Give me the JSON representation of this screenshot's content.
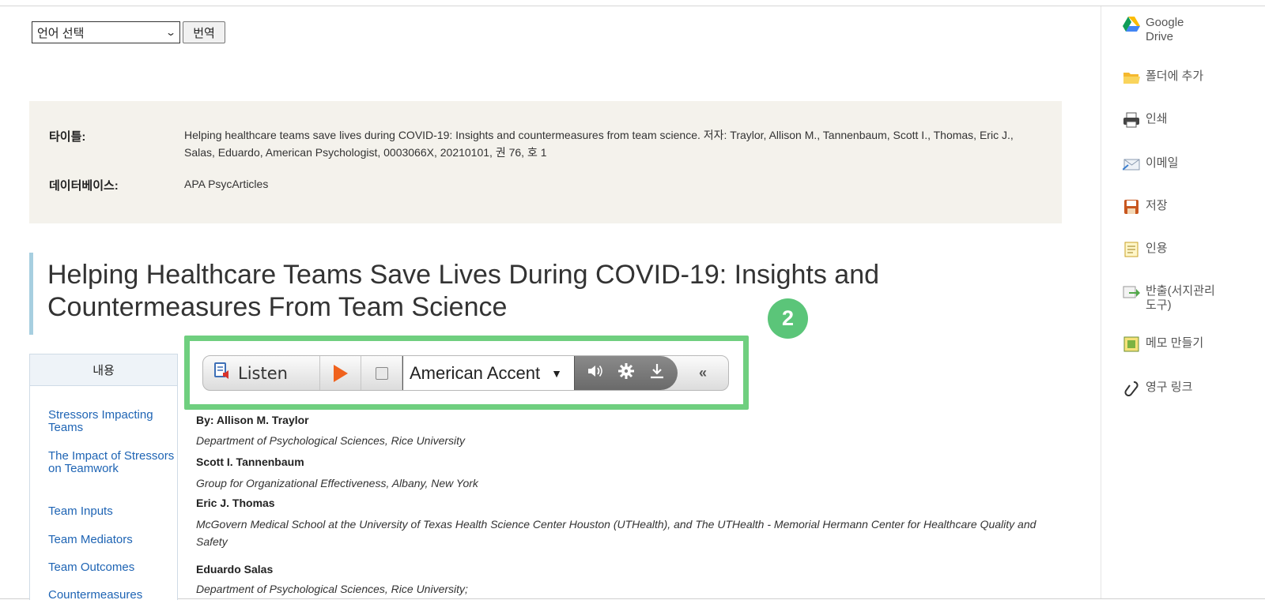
{
  "translate": {
    "select_value": "언어 선택",
    "button": "번역"
  },
  "citation": {
    "title_label": "타이틀:",
    "title_value": "Helping healthcare teams save lives during COVID-19: Insights and countermeasures from team science. 저자: Traylor, Allison M., Tannenbaum, Scott I., Thomas, Eric J., Salas, Eduardo, American Psychologist, 0003066X, 20210101, 권 76, 호 1",
    "db_label": "데이터베이스:",
    "db_value": "APA PsycArticles"
  },
  "article": {
    "title": "Helping Healthcare Teams Save Lives During COVID-19: Insights and Countermeasures From Team Science",
    "step_badge": "2"
  },
  "toc": {
    "heading": "내용",
    "items": [
      "Stressors Impacting Teams",
      "The Impact of Stressors on Teamwork",
      "Team Inputs",
      "Team Mediators",
      "Team Outcomes",
      "Countermeasures"
    ]
  },
  "readspeaker": {
    "listen": "Listen",
    "voice": "American Accent",
    "collapse": "«"
  },
  "authors": [
    {
      "name": "By: Allison M. Traylor",
      "affiliation": "Department of Psychological Sciences, Rice University"
    },
    {
      "name": "Scott I. Tannenbaum",
      "affiliation": "Group for Organizational Effectiveness, Albany, New York"
    },
    {
      "name": "Eric J. Thomas",
      "affiliation": "McGovern Medical School at the University of Texas Health Science Center Houston (UTHealth), and The UTHealth - Memorial Hermann Center for Healthcare Quality and Safety"
    },
    {
      "name": "Eduardo Salas",
      "affiliation": "Department of Psychological Sciences, Rice University;"
    }
  ],
  "tools": [
    {
      "icon": "google-drive-icon",
      "label": "Google Drive"
    },
    {
      "icon": "folder-icon",
      "label": "폴더에 추가"
    },
    {
      "icon": "print-icon",
      "label": "인쇄"
    },
    {
      "icon": "email-icon",
      "label": "이메일"
    },
    {
      "icon": "save-icon",
      "label": "저장"
    },
    {
      "icon": "cite-icon",
      "label": "인용"
    },
    {
      "icon": "export-icon",
      "label": "반출(서지관리도구)"
    },
    {
      "icon": "note-icon",
      "label": "메모 만들기"
    },
    {
      "icon": "permalink-icon",
      "label": "영구 링크"
    }
  ],
  "colors": {
    "highlight": "#6fcf7f",
    "badge": "#5bc579",
    "link": "#1e64b4",
    "cite_bg": "#f4f2ec"
  }
}
